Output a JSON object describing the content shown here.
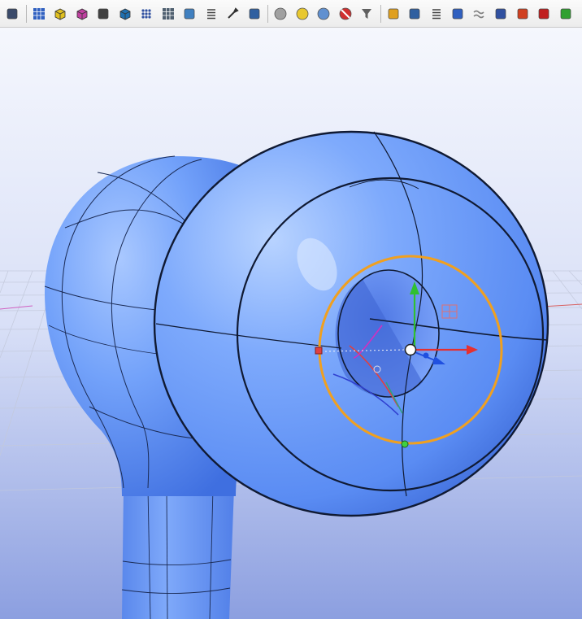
{
  "toolbar": {
    "groups": [
      [
        {
          "icon": "modeling-mode-icon",
          "color": "#3a4a6a"
        }
      ],
      [
        {
          "icon": "grid-surface-icon",
          "color": "#3060c0"
        },
        {
          "icon": "box-solid-icon",
          "color": "#e0c020"
        },
        {
          "icon": "wireframe-box-icon",
          "color": "#c040a0"
        },
        {
          "icon": "dimension-icon",
          "color": "#404040"
        },
        {
          "icon": "cube-view-icon",
          "color": "#2070b0"
        },
        {
          "icon": "point-cloud-icon",
          "color": "#3050a0"
        },
        {
          "icon": "mesh-icon",
          "color": "#506070"
        },
        {
          "icon": "extrude-icon",
          "color": "#4080c0"
        },
        {
          "icon": "layer-list-icon",
          "color": "#404040"
        },
        {
          "icon": "tools-icon",
          "color": "#303030"
        },
        {
          "icon": "group-objects-icon",
          "color": "#3060a0"
        }
      ],
      [
        {
          "icon": "sphere-gray-icon",
          "color": "#a0a0a0"
        },
        {
          "icon": "sphere-yellow-icon",
          "color": "#e8c830"
        },
        {
          "icon": "sphere-blue-icon",
          "color": "#6090d0"
        },
        {
          "icon": "sphere-forbidden-icon",
          "color": "#d03030"
        },
        {
          "icon": "filter-icon",
          "color": "#606060"
        }
      ],
      [
        {
          "icon": "puzzle-icon",
          "color": "#e0a020"
        },
        {
          "icon": "surface-analysis-icon",
          "color": "#3060a0"
        },
        {
          "icon": "layers-stack-icon",
          "color": "#404040"
        },
        {
          "icon": "material-book-icon",
          "color": "#3060c0"
        },
        {
          "icon": "wave-icon",
          "color": "#808080"
        },
        {
          "icon": "symmetry-icon",
          "color": "#3050a0"
        },
        {
          "icon": "paint-icon",
          "color": "#d04020"
        },
        {
          "icon": "manipulator-icon",
          "color": "#c02020"
        },
        {
          "icon": "chart-icon",
          "color": "#30a030"
        }
      ]
    ]
  },
  "viewport": {
    "background_top": "#f5f7fd",
    "background_bottom": "#8c9fe0",
    "surface_color": "#6d9cf7",
    "selection_color": "#f0a020",
    "manipulator": {
      "x_color": "#e53030",
      "y_color": "#30c030",
      "z_color": "#2050e0"
    }
  }
}
